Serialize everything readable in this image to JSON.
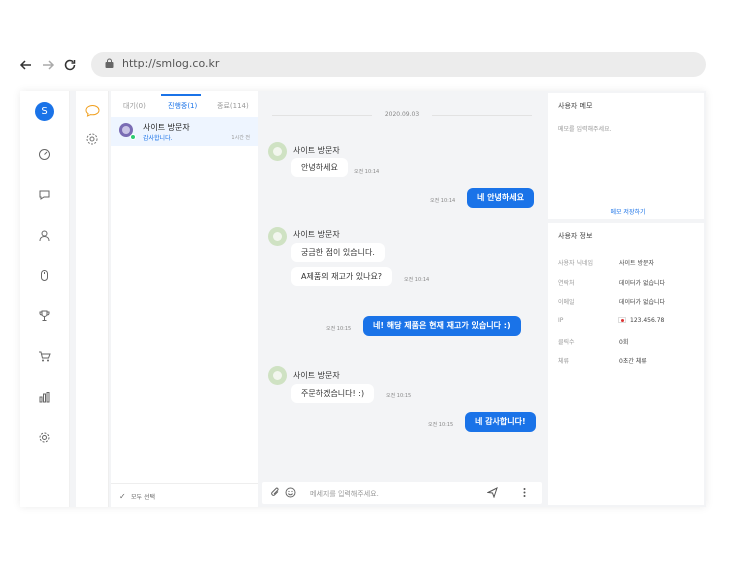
{
  "browser": {
    "url": "http://smlog.co.kr"
  },
  "rail": {
    "avatar_letter": "S",
    "icons": [
      "dashboard-icon",
      "chat-icon",
      "users-icon",
      "mouse-icon",
      "trophy-icon",
      "cart-icon",
      "bar-chart-icon",
      "settings-icon"
    ]
  },
  "list": {
    "tabs": [
      {
        "label": "대기(0)"
      },
      {
        "label": "진행중(1)"
      },
      {
        "label": "종료(114)"
      }
    ],
    "items": [
      {
        "name": "사이트 방문자",
        "last_message": "감사합니다.",
        "time": "1시간 전"
      }
    ],
    "footer_label": "모두 선택"
  },
  "chat": {
    "date": "2020.09.03",
    "visitor_name": "사이트 방문자",
    "messages": [
      {
        "text": "안녕하세요",
        "time": "오전 10:14"
      },
      {
        "text": "네 안녕하세요",
        "time": "오전 10:14"
      },
      {
        "text": "궁금한 점이 있습니다.",
        "time": ""
      },
      {
        "text": "A제품의 재고가 있나요?",
        "time": "오전 10:14"
      },
      {
        "text": "네! 해당 제품은 현재 재고가 있습니다 :)",
        "time": "오전 10:15"
      },
      {
        "text": "주문하겠습니다! :)",
        "time": "오전 10:15"
      },
      {
        "text": "네 감사합니다!",
        "time": "오전 10:15"
      }
    ],
    "composer_placeholder": "메세지를 입력해주세요."
  },
  "memo": {
    "title": "사용자 메모",
    "placeholder": "메모를 입력해주세요.",
    "save_label": "메모 저장하기"
  },
  "user_info": {
    "title": "사용자 정보",
    "rows": [
      {
        "label": "사용자 닉네임",
        "value": "사이트 방문자"
      },
      {
        "label": "연락처",
        "value": "데이터가 없습니다"
      },
      {
        "label": "이메일",
        "value": "데이터가 없습니다"
      },
      {
        "label": "IP",
        "value": "123.456.78"
      },
      {
        "label": "클릭수",
        "value": "0회"
      },
      {
        "label": "체류",
        "value": "0초간 체류"
      }
    ]
  },
  "colors": {
    "accent": "#1a73e8",
    "panel_bg": "#f3f4f6"
  }
}
